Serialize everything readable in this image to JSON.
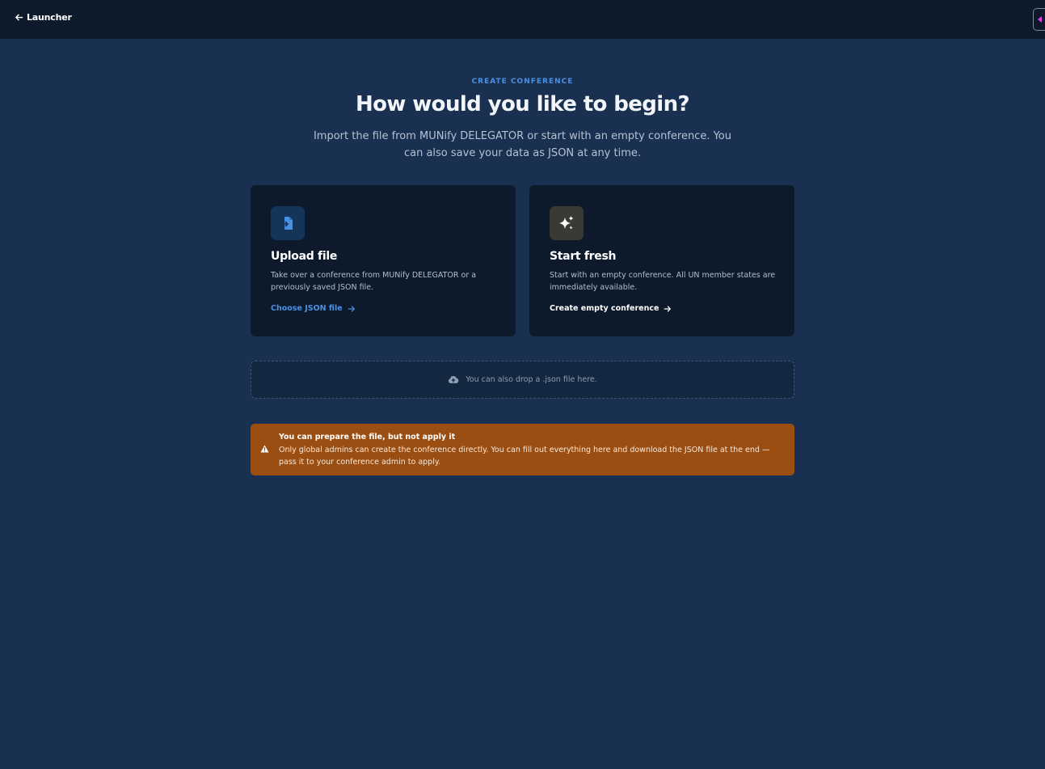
{
  "topbar": {
    "back_label": "Launcher"
  },
  "header": {
    "eyebrow": "CREATE CONFERENCE",
    "title": "How would you like to begin?",
    "subtitle": "Import the file from MUNify DELEGATOR or start with an empty conference. You can also save your data as JSON at any time."
  },
  "cards": {
    "upload": {
      "icon": "file-import-icon",
      "title": "Upload file",
      "description": "Take over a conference from MUNify DELEGATOR or a previously saved JSON file.",
      "action": "Choose JSON file"
    },
    "fresh": {
      "icon": "sparkles-icon",
      "title": "Start fresh",
      "description": "Start with an empty conference. All UN member states are immediately available.",
      "action": "Create empty conference"
    }
  },
  "dropzone": {
    "icon": "cloud-upload-icon",
    "text": "You can also drop a .json file here."
  },
  "alert": {
    "icon": "warning-icon",
    "title": "You can prepare the file, but not apply it",
    "body": "Only global admins can create the conference directly. You can fill out everything here and download the JSON file at the end — pass it to your conference admin to apply."
  },
  "colors": {
    "background": "#1a3050",
    "topbar": "#0d1a2c",
    "card": "#0d1a2c",
    "accent": "#4a90e2",
    "warning": "#9a4e12",
    "side_toggle_arrow": "#e040e0"
  }
}
